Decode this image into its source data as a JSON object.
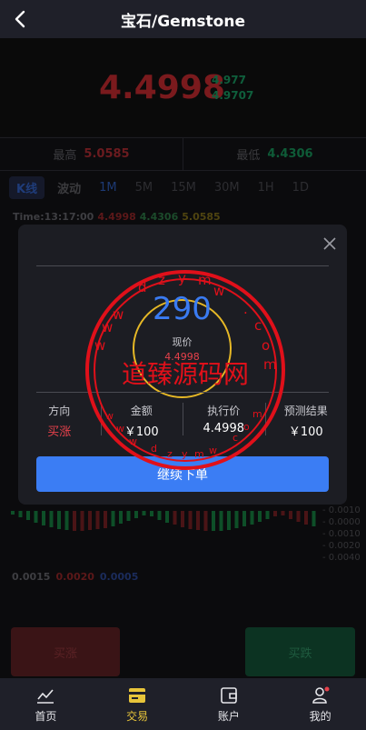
{
  "header": {
    "title": "宝石/Gemstone"
  },
  "price": {
    "big": "4.4998",
    "small_1": "4.977",
    "small_2": "4.9707"
  },
  "highlow": {
    "high_label": "最高",
    "high_value": "5.0585",
    "low_label": "最低",
    "low_value": "4.4306"
  },
  "tabs": [
    "K线",
    "波动",
    "1M",
    "5M",
    "15M",
    "30M",
    "1H",
    "1D"
  ],
  "time_row": {
    "time": "Time:13:17:00",
    "v1": "4.4998",
    "v2": "4.4306",
    "v3": "5.0585"
  },
  "bottom_vals": [
    "0.0015",
    "0.0020",
    "0.0005"
  ],
  "right_vals": [
    "- 0.0010",
    "- 0.0000",
    "- 0.0010",
    "- 0.0020",
    "- 0.0040"
  ],
  "buttons": {
    "buy": "买涨",
    "sell": "买跌"
  },
  "modal": {
    "countdown": "290",
    "current_label": "现价",
    "current_value": "4.4998",
    "direction_label": "方向",
    "direction_value": "买涨",
    "amount_label": "金额",
    "amount_value": "￥100",
    "strike_label": "执行价",
    "strike_value": "4.4998",
    "result_label": "预测结果",
    "result_value": "￥100",
    "continue_label": "继续下单"
  },
  "watermark": {
    "domain": "dzymw.com",
    "name": "道臻源码网"
  },
  "tabbar": [
    {
      "label": "首页",
      "icon": "chart-line-icon"
    },
    {
      "label": "交易",
      "icon": "trade-card-icon"
    },
    {
      "label": "账户",
      "icon": "wallet-icon"
    },
    {
      "label": "我的",
      "icon": "user-icon"
    }
  ],
  "colors": {
    "accent_blue": "#3b7df4",
    "up_red": "#e6414b",
    "gold": "#e7c43a"
  }
}
